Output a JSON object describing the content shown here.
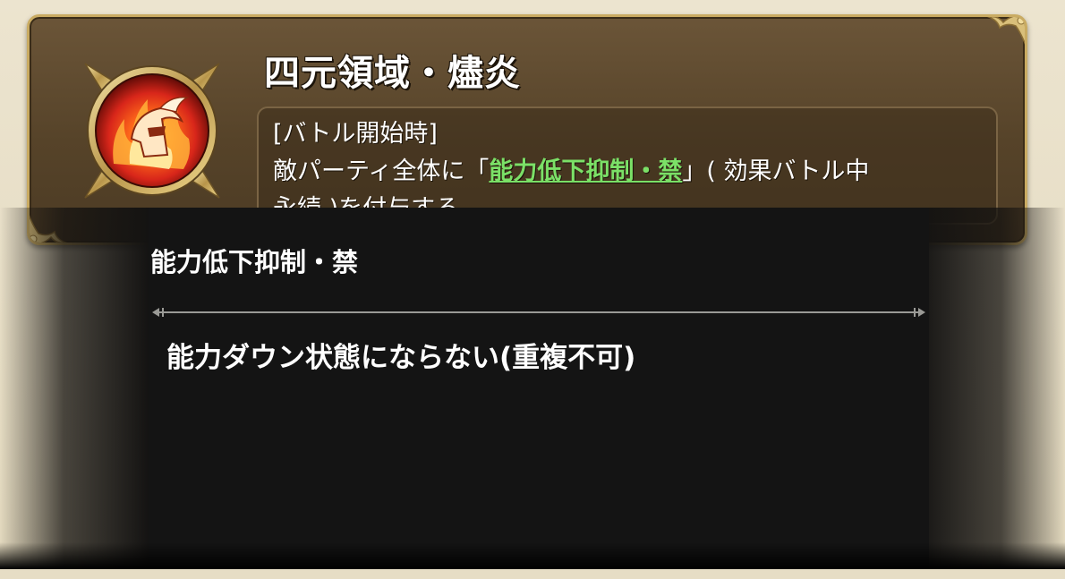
{
  "skill": {
    "title": "四元領域・燼炎",
    "emblem_icon": "flame-helmet-emblem-icon",
    "description": {
      "timing": "[バトル開始時]",
      "prefix": "敵パーティ全体に「",
      "effect_link": "能力低下抑制・禁",
      "suffix": "」( 効果バトル中",
      "continuation": "永続 )を付与する"
    }
  },
  "tooltip": {
    "title": "能力低下抑制・禁",
    "body": "能力ダウン状態にならない(重複不可)"
  },
  "colors": {
    "link_green": "#7be067",
    "panel_brown": "#564329",
    "panel_border_gold": "#c9ab62",
    "popup_bg": "#141414",
    "emblem_red": "#d8261a"
  }
}
